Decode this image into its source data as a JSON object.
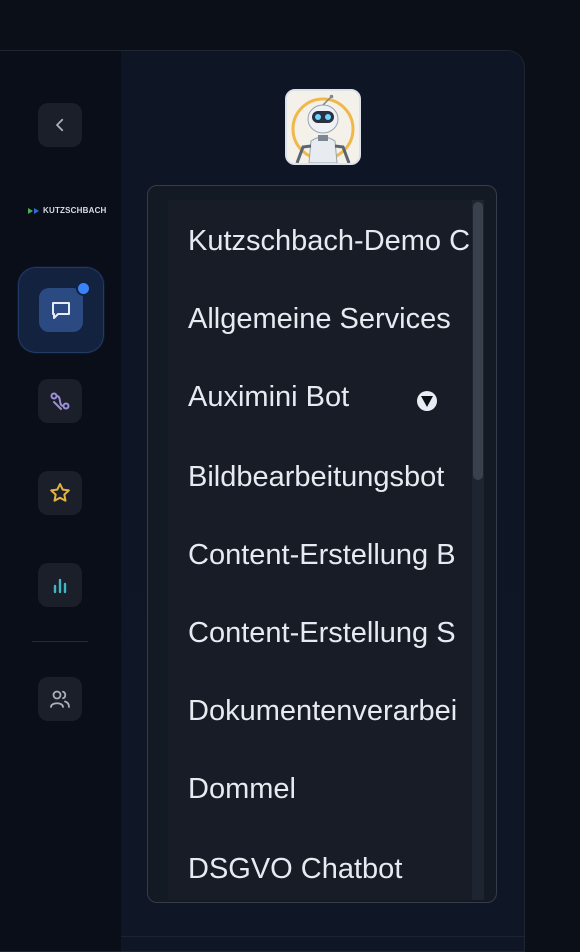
{
  "brand": {
    "name": "KUTZSCHBACH"
  },
  "sidebar": {
    "items": [
      {
        "icon": "chevron-left-icon",
        "label": ""
      },
      {
        "icon": "message-square-icon",
        "label": "",
        "active": true,
        "notification": true
      },
      {
        "icon": "route-icon",
        "label": ""
      },
      {
        "icon": "star-icon",
        "label": ""
      },
      {
        "icon": "bar-chart-icon",
        "label": ""
      },
      {
        "icon": "users-icon",
        "label": ""
      }
    ]
  },
  "bot": {
    "avatar_icon": "robot-avatar"
  },
  "dropdown": {
    "options": [
      "Kutzschbach-Demo C",
      "Allgemeine Services",
      "Auximini Bot",
      "Bildbearbeitungsbot",
      "Content-Erstellung B",
      "Content-Erstellung S",
      "Dokumentenverarbei",
      "Dommel",
      "DSGVO Chatbot"
    ],
    "visible_fraction": 0.4
  },
  "colors": {
    "background": "#0b0f17",
    "accent": "#3b82f6",
    "dropdown_bg": "#171c26",
    "text": "#e7eaf0"
  }
}
